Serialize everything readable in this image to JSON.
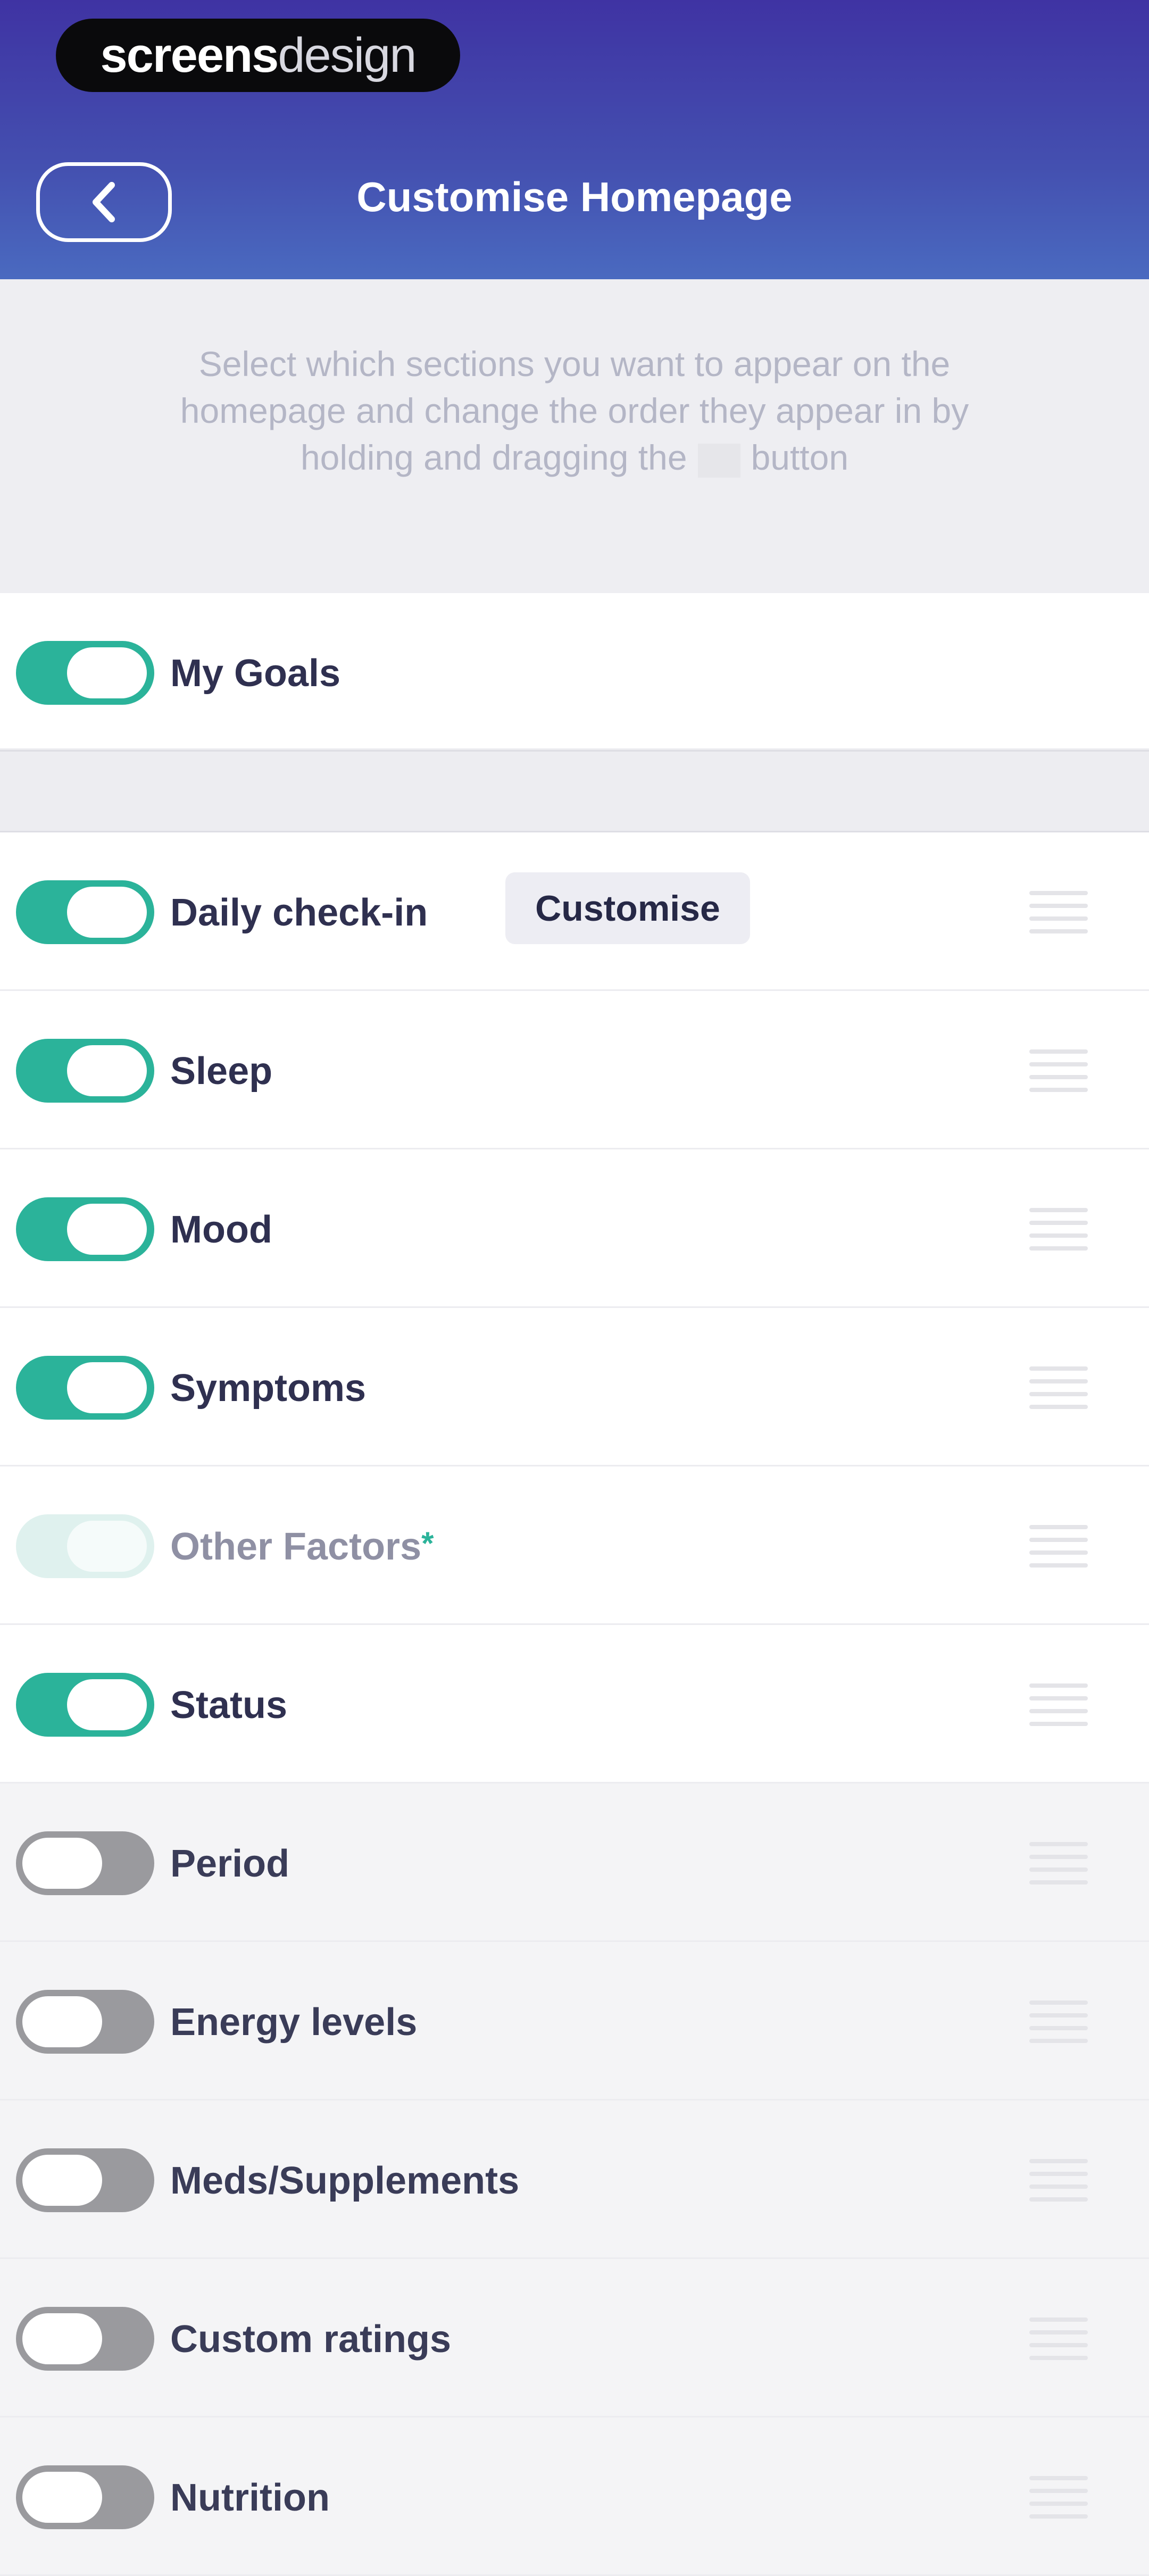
{
  "brand": {
    "bold": "screens",
    "light": "design"
  },
  "header": {
    "title": "Customise Homepage",
    "back_icon": "chevron-left-icon"
  },
  "intro": {
    "text_before": "Select which sections you want to appear on the homepage and change the order they appear in by holding and dragging the",
    "text_after": "button"
  },
  "pinned": {
    "label": "My Goals",
    "enabled": true
  },
  "customise_label": "Customise",
  "sections": [
    {
      "label": "Daily check-in",
      "enabled": true
    },
    {
      "label": "Sleep",
      "enabled": true
    },
    {
      "label": "Mood",
      "enabled": true
    },
    {
      "label": "Symptoms",
      "enabled": true
    },
    {
      "label": "Other Factors",
      "enabled": true,
      "disabled_look": true,
      "asterisk": "*"
    },
    {
      "label": "Status",
      "enabled": true
    },
    {
      "label": "Period",
      "enabled": false
    },
    {
      "label": "Energy levels",
      "enabled": false
    },
    {
      "label": "Meds/Supplements",
      "enabled": false
    },
    {
      "label": "Custom ratings",
      "enabled": false
    },
    {
      "label": "Nutrition",
      "enabled": false
    }
  ],
  "colors": {
    "accent": "#2bb39a",
    "header_top": "#3f33a3",
    "header_bottom": "#4a6ac0",
    "toggle_off": "#9a9a9e"
  }
}
